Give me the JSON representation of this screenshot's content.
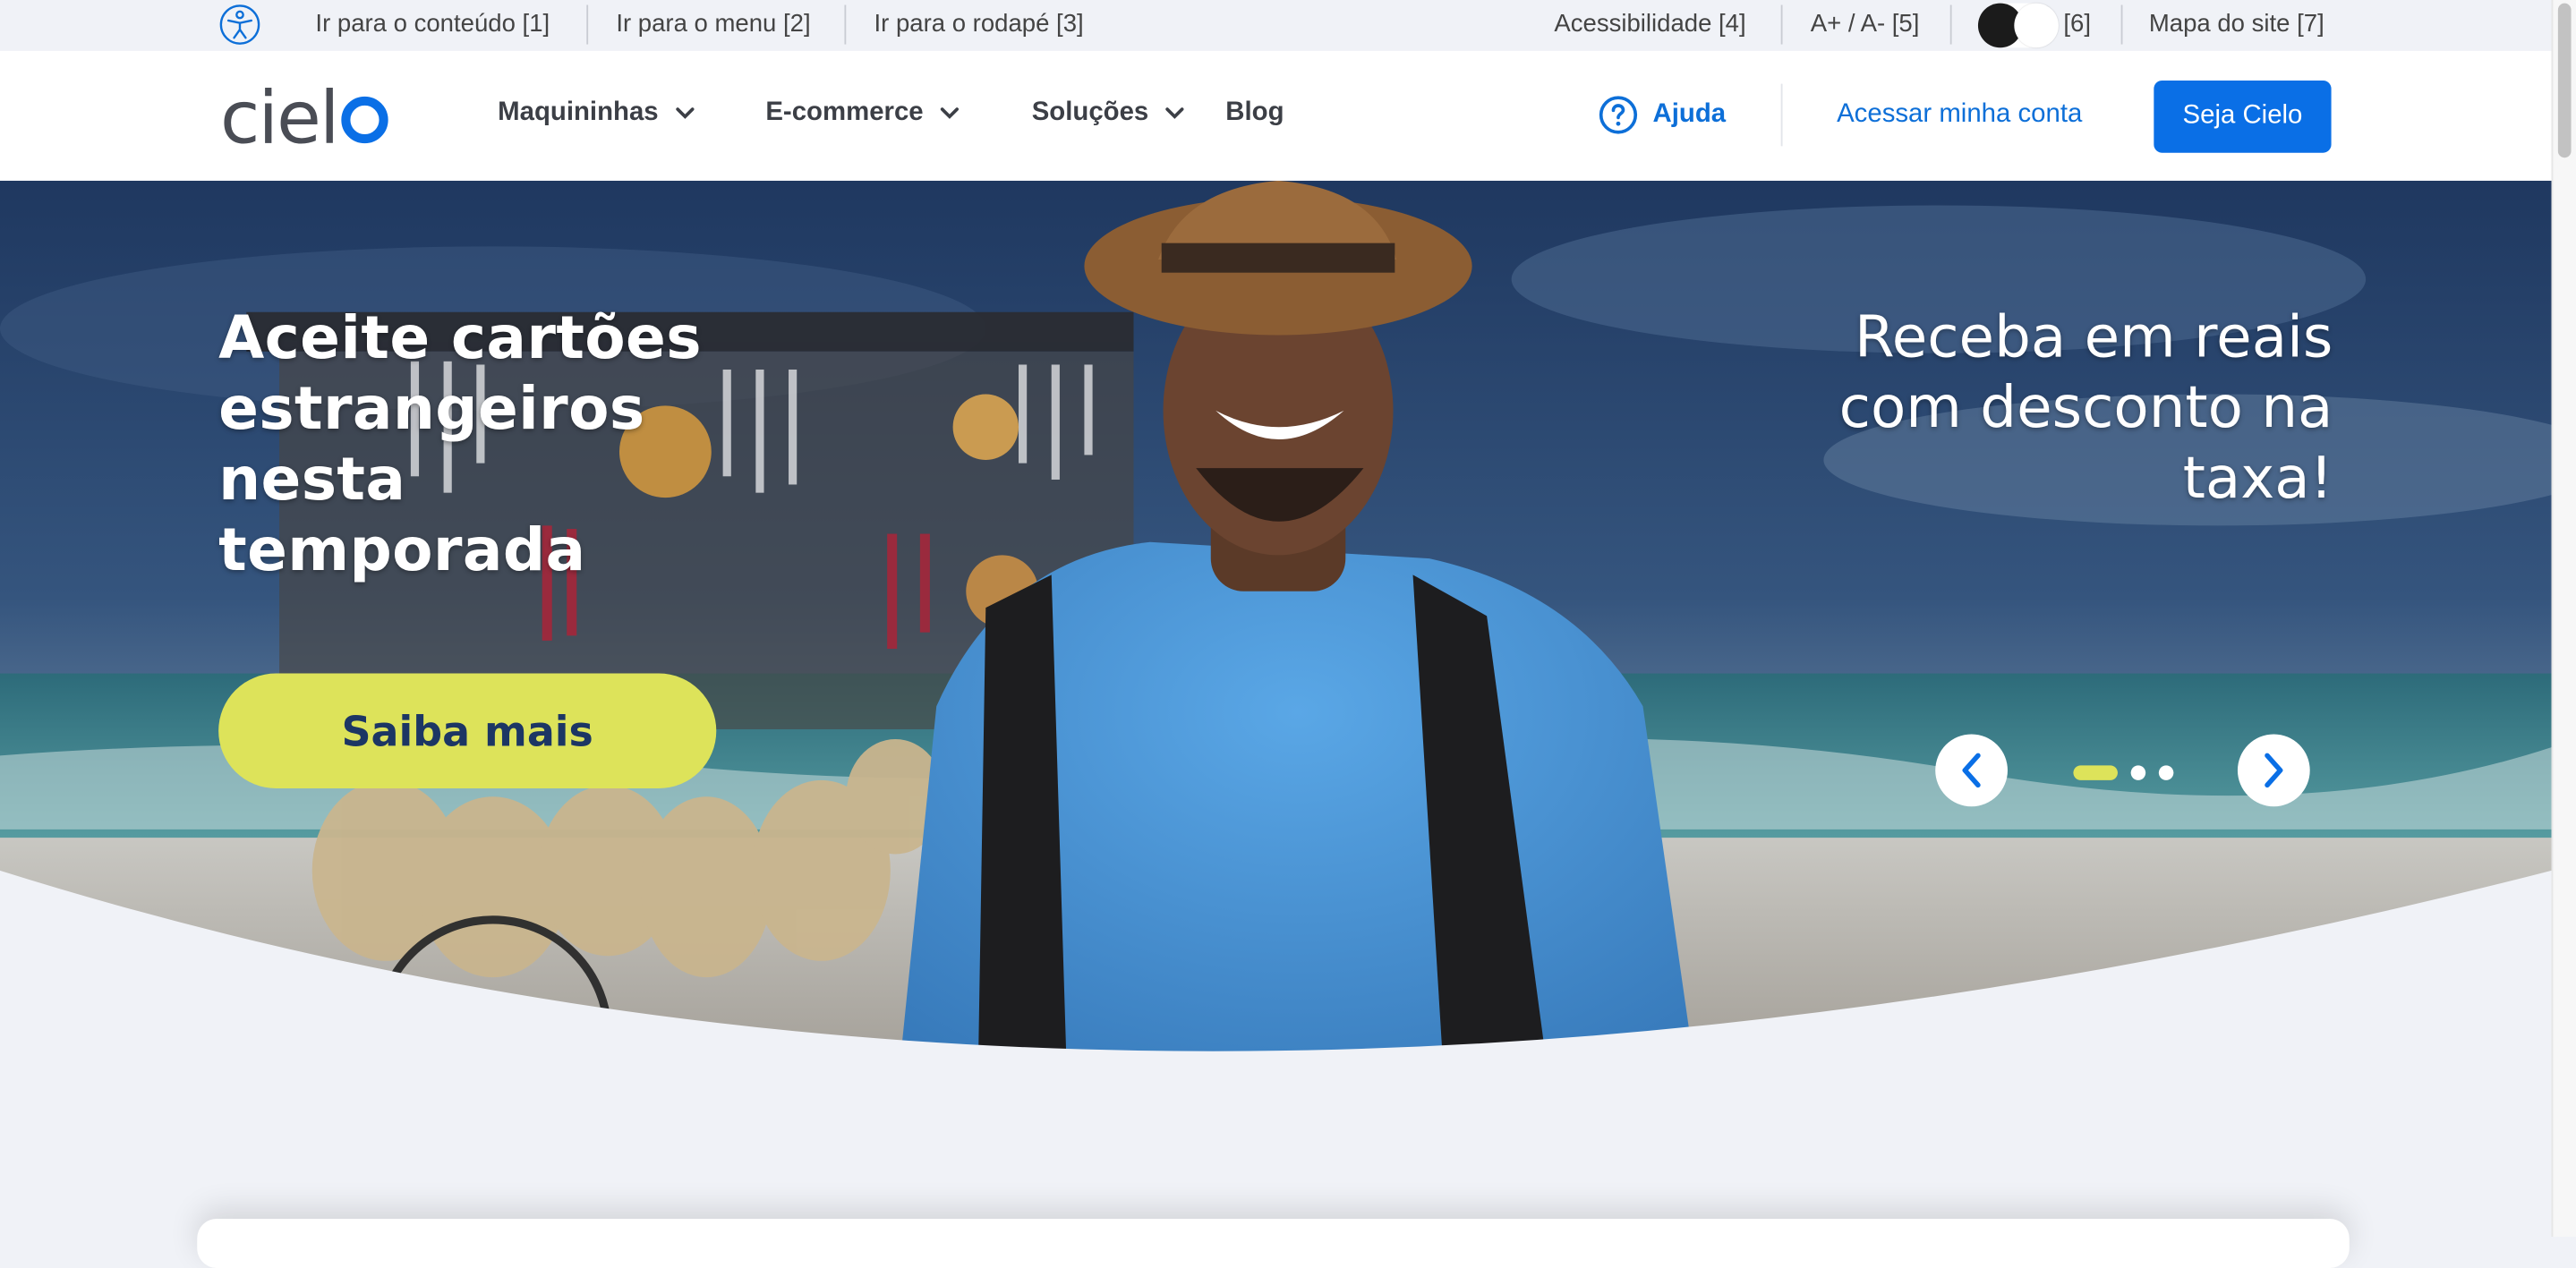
{
  "topbar": {
    "links": [
      {
        "label": "Ir para o conteúdo [1]"
      },
      {
        "label": "Ir para o menu [2]"
      },
      {
        "label": "Ir para o rodapé [3]"
      }
    ],
    "accessibility_label": "Acessibilidade [4]",
    "font_size_label": "A+ / A- [5]",
    "contrast_label": "[6]",
    "sitemap_label": "Mapa do site [7]"
  },
  "header": {
    "logo_text": "cielo",
    "nav": [
      {
        "label": "Maquininhas",
        "has_dropdown": true
      },
      {
        "label": "E-commerce",
        "has_dropdown": true
      },
      {
        "label": "Soluções",
        "has_dropdown": true
      },
      {
        "label": "Blog",
        "has_dropdown": false
      }
    ],
    "help_label": "Ajuda",
    "account_link": "Acessar minha conta",
    "cta_label": "Seja Cielo"
  },
  "hero": {
    "title": "Aceite cartões estrangeiros nesta temporada",
    "subtitle": "Receba em reais com desconto na taxa!",
    "button_label": "Saiba mais",
    "slides_total": 3,
    "active_slide": 1
  },
  "colors": {
    "brand_blue": "#0a6fe6",
    "link_blue": "#0d6fd8",
    "accent_yellow": "#dde35a",
    "button_text": "#1c3664",
    "page_background": "#f0f2f7"
  },
  "icons": [
    "accessibility-icon",
    "chevron-down-icon",
    "help-circle-icon",
    "chevron-left-icon",
    "chevron-right-icon"
  ]
}
